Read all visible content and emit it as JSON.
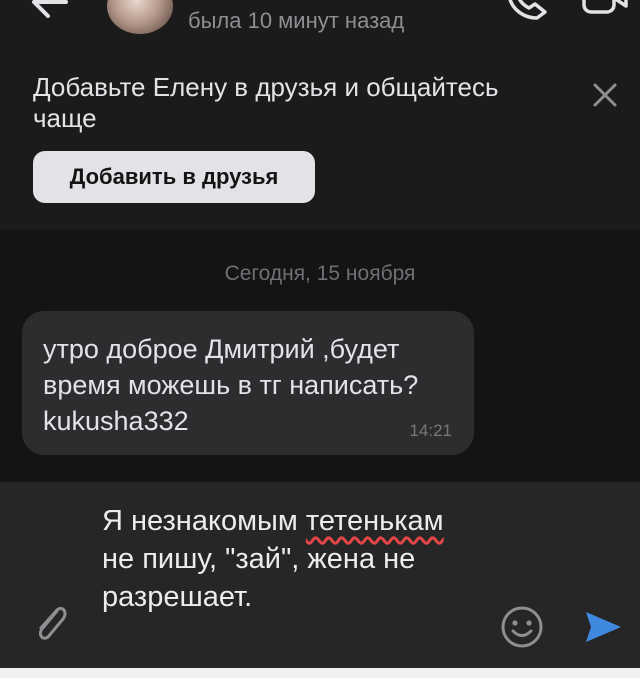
{
  "header": {
    "status": "была 10 минут назад",
    "icons": {
      "back": "back-arrow-icon",
      "call": "phone-icon",
      "video": "video-camera-icon"
    }
  },
  "banner": {
    "text": "Добавьте Елену в друзья и общайтесь чаще",
    "add_button": "Добавить в друзья",
    "close_icon": "close-icon"
  },
  "chat": {
    "date_separator": "Сегодня, 15 ноября",
    "messages": [
      {
        "text": "утро доброе Дмитрий ,будет время можешь в тг написать? kukusha332",
        "time": "14:21"
      }
    ]
  },
  "composer": {
    "underlined_word": "тетенькам",
    "text_before": "Я незнакомым ",
    "text_after": " не пишу, \"зай\", жена не разрешает.",
    "icons": {
      "attach": "paperclip-icon",
      "emoji": "emoji-icon",
      "send": "send-icon"
    }
  },
  "colors": {
    "background": "#141414",
    "panel": "#1b1b1b",
    "bubble": "#2c2d2e",
    "accent": "#3f8ae0",
    "text": "#e1e3e6",
    "spellcheck": "#e64646"
  }
}
